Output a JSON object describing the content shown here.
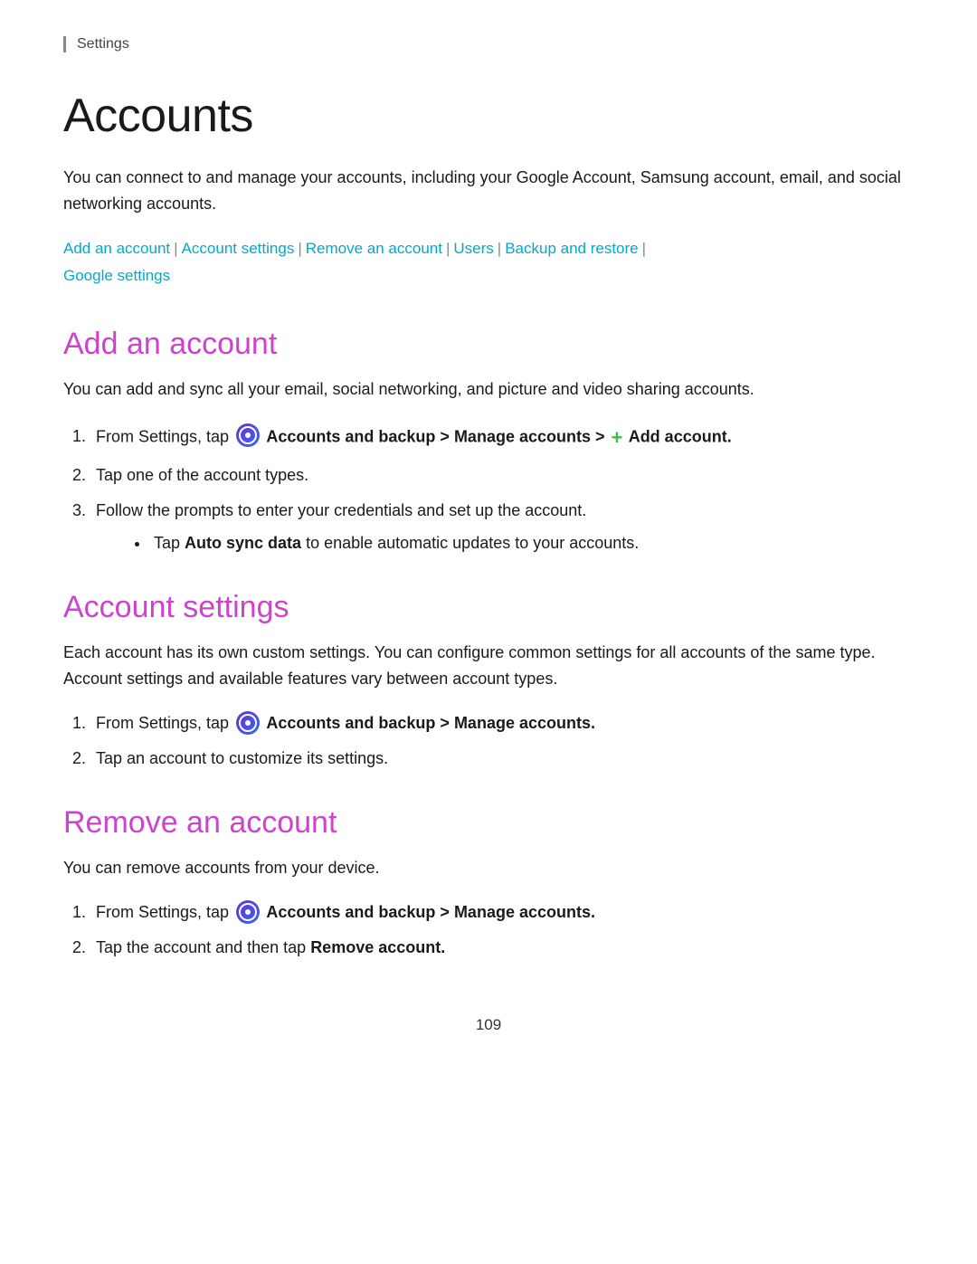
{
  "breadcrumb": "Settings",
  "page_title": "Accounts",
  "intro_text": "You can connect to and manage your accounts, including your Google Account, Samsung account, email, and social networking accounts.",
  "toc": {
    "links": [
      {
        "label": "Add an account",
        "id": "add-an-account"
      },
      {
        "label": "Account settings",
        "id": "account-settings"
      },
      {
        "label": "Remove an account",
        "id": "remove-an-account"
      },
      {
        "label": "Users",
        "id": "users"
      },
      {
        "label": "Backup and restore",
        "id": "backup-and-restore"
      },
      {
        "label": "Google settings",
        "id": "google-settings"
      }
    ]
  },
  "sections": {
    "add_account": {
      "title": "Add an account",
      "intro": "You can add and sync all your email, social networking, and picture and video sharing accounts.",
      "steps": [
        {
          "text_before": "From Settings, tap",
          "icon": "settings-icon",
          "text_bold": "Accounts and backup > Manage accounts >",
          "add_icon": true,
          "text_bold2": "Add account."
        },
        {
          "text": "Tap one of the account types."
        },
        {
          "text": "Follow the prompts to enter your credentials and set up the account.",
          "bullet": "Tap Auto sync data to enable automatic updates to your accounts.",
          "bullet_bold": "Auto sync data"
        }
      ]
    },
    "account_settings": {
      "title": "Account settings",
      "intro": "Each account has its own custom settings. You can configure common settings for all accounts of the same type. Account settings and available features vary between account types.",
      "steps": [
        {
          "text_before": "From Settings, tap",
          "icon": "settings-icon",
          "text_bold": "Accounts and backup > Manage accounts."
        },
        {
          "text": "Tap an account to customize its settings."
        }
      ]
    },
    "remove_account": {
      "title": "Remove an account",
      "intro": "You can remove accounts from your device.",
      "steps": [
        {
          "text_before": "From Settings, tap",
          "icon": "settings-icon",
          "text_bold": "Accounts and backup > Manage accounts."
        },
        {
          "text_before": "Tap the account and then tap",
          "text_bold": "Remove account."
        }
      ]
    }
  },
  "page_number": "109"
}
